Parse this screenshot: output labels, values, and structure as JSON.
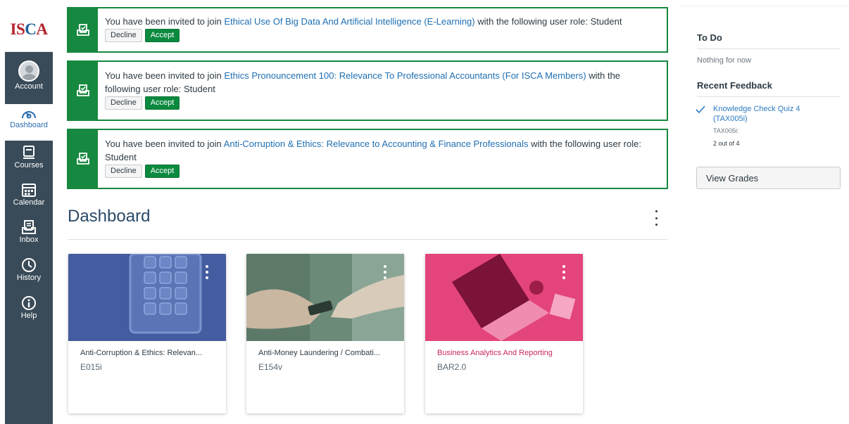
{
  "brand": {
    "logo_text_1": "IS",
    "logo_text_2": "C",
    "logo_text_3": "A"
  },
  "nav": {
    "items": [
      {
        "label": "Account",
        "icon": "avatar-icon"
      },
      {
        "label": "Dashboard",
        "icon": "dashboard-icon"
      },
      {
        "label": "Courses",
        "icon": "courses-icon"
      },
      {
        "label": "Calendar",
        "icon": "calendar-icon"
      },
      {
        "label": "Inbox",
        "icon": "inbox-icon"
      },
      {
        "label": "History",
        "icon": "history-icon"
      },
      {
        "label": "Help",
        "icon": "help-icon"
      }
    ],
    "active": "Dashboard"
  },
  "invitations": [
    {
      "prefix": "You have been invited to join ",
      "course": "Ethical Use Of Big Data And Artificial Intelligence (E-Learning)",
      "suffix": " with the following user role: Student",
      "decline": "Decline",
      "accept": "Accept"
    },
    {
      "prefix": "You have been invited to join ",
      "course": "Ethics Pronouncement 100: Relevance To Professional Accountants (For ISCA Members)",
      "suffix": " with the following user role: Student",
      "decline": "Decline",
      "accept": "Accept"
    },
    {
      "prefix": "You have been invited to join ",
      "course": "Anti-Corruption & Ethics: Relevance to Accounting & Finance Professionals",
      "suffix": " with the following user role: Student",
      "decline": "Decline",
      "accept": "Accept"
    }
  ],
  "dashboard": {
    "title": "Dashboard"
  },
  "cards": [
    {
      "name": "Anti-Corruption & Ethics: Relevan...",
      "code": "E015i",
      "color": "#4a63a8",
      "name_color": "#2d3b45"
    },
    {
      "name": "Anti-Money Laundering / Combati...",
      "code": "E154v",
      "color": "#6b8a78",
      "name_color": "#2d3b45"
    },
    {
      "name": "Business Analytics And Reporting",
      "code": "BAR2.0",
      "color": "#e0366f",
      "name_color": "#c9275d"
    }
  ],
  "sidebar": {
    "todo_heading": "To Do",
    "todo_empty": "Nothing for now",
    "feedback_heading": "Recent Feedback",
    "feedback_item": {
      "title": "Knowledge Check Quiz 4 (TAX005i)",
      "course": "TAX005i:",
      "score": "2 out of 4"
    },
    "view_grades": "View Grades"
  },
  "colors": {
    "invite_green": "#17883f",
    "nav_bg": "#394b58",
    "link_blue": "#1f6fb2"
  }
}
